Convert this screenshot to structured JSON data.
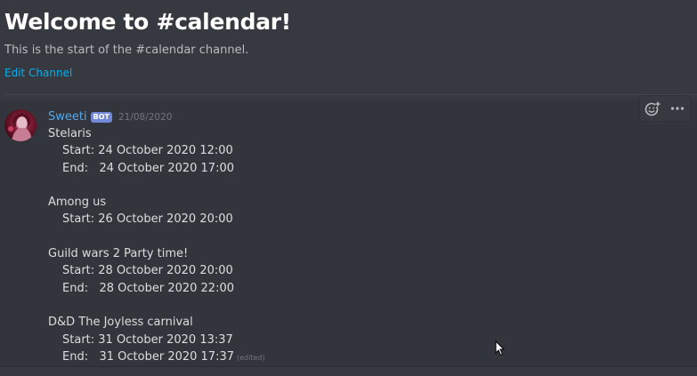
{
  "welcome": {
    "title": "Welcome to #calendar!",
    "subtitle": "This is the start of the #calendar channel.",
    "edit_link": "Edit Channel"
  },
  "message": {
    "username": "Sweeti",
    "bot_tag": "BOT",
    "timestamp": "21/08/2020",
    "avatar_icon": "user-avatar",
    "edited_label": "(edited)",
    "lines": [
      {
        "text": "Stelaris",
        "indent": false
      },
      {
        "text": "Start: 24 October 2020 12:00",
        "indent": true
      },
      {
        "text": "End:   24 October 2020 17:00",
        "indent": true
      },
      {
        "text": "",
        "indent": false
      },
      {
        "text": "Among us",
        "indent": false
      },
      {
        "text": "Start: 26 October 2020 20:00",
        "indent": true
      },
      {
        "text": "",
        "indent": false
      },
      {
        "text": "Guild wars 2 Party time!",
        "indent": false
      },
      {
        "text": "Start: 28 October 2020 20:00",
        "indent": true
      },
      {
        "text": "End:   28 October 2020 22:00",
        "indent": true
      },
      {
        "text": "",
        "indent": false
      },
      {
        "text": "D&D The Joyless carnival",
        "indent": false
      },
      {
        "text": "Start: 31 October 2020 13:37",
        "indent": true
      },
      {
        "text": "End:   31 October 2020 17:37",
        "indent": true
      }
    ]
  },
  "actions": {
    "add_reaction_icon": "add-reaction-icon",
    "more_icon": "more-options-icon"
  },
  "colors": {
    "background": "#36393f",
    "message_hover": "#32353b",
    "username": "#57a6e8",
    "bot_tag": "#7289da",
    "link": "#00b0f4"
  }
}
